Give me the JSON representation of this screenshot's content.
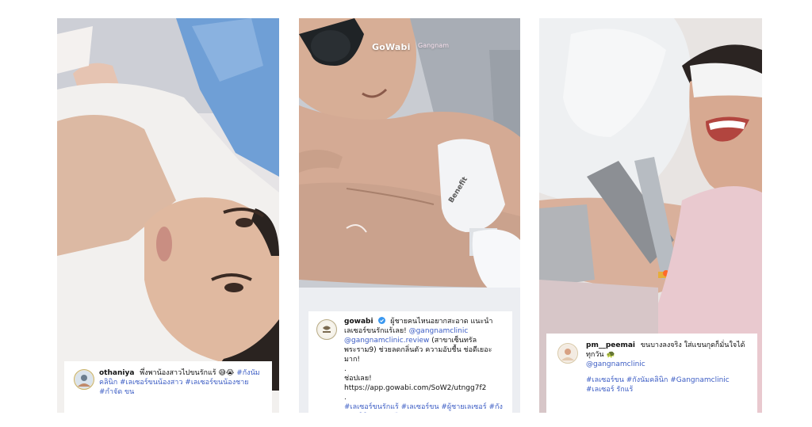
{
  "posts": [
    {
      "username": "othaniya",
      "caption_text": "พึ่งพาน้องสาวไปขนรักแร้",
      "emoji": "😅😭",
      "tags": "#กังนัม คลินิก #เลเซอร์ขนน้องสาว #เลเซอร์ขนน้องชาย #กำจัด ขน"
    },
    {
      "username": "gowabi",
      "watermark": "GoWabi",
      "watermark_partner": "Gangnam",
      "device_label": "Benefit",
      "caption_line1": "ผู้ชายคนไหนอยากสะอาด แนะนำเลเซอร์ขนรักแร้เลย!",
      "mention1": "@gangnamclinic",
      "mention2": "@gangnamclinic.review",
      "caption_line2": "(สาขาเซ็นทรัลพระราม9) ช่วยลดกลิ่นตัว ความอับชื้น ช่อดีเยอะมาก!",
      "dot": ".",
      "cta_prefix": "ช่อปเลย!",
      "link": "https://app.gowabi.com/SoW2/utngg7f2",
      "dot2": ".",
      "tags": "#เลเซอร์ขนรักแร้ #เลเซอร์ขน #ผู้ชายเลเซอร์ #กังนัมคลินิก #ของดีบอกต่อ"
    },
    {
      "username": "pm__peemai",
      "caption_line1": "ขนบางลงจริง ใส่แขนกุดก็มั่นใจได้ทุกวัน",
      "emoji": "🐢",
      "mention": "@gangnamclinic",
      "tags": "#เลเซอร์ขน #กังนัมคลินิก #Gangnamclinic #เลเซอร์ รักแร้"
    }
  ],
  "colors": {
    "tag": "#3b5cc4",
    "card_bg": "#ffffff"
  },
  "icons": [
    "avatar-othaniya",
    "avatar-gowabi",
    "verified-badge-icon",
    "avatar-peemai"
  ]
}
